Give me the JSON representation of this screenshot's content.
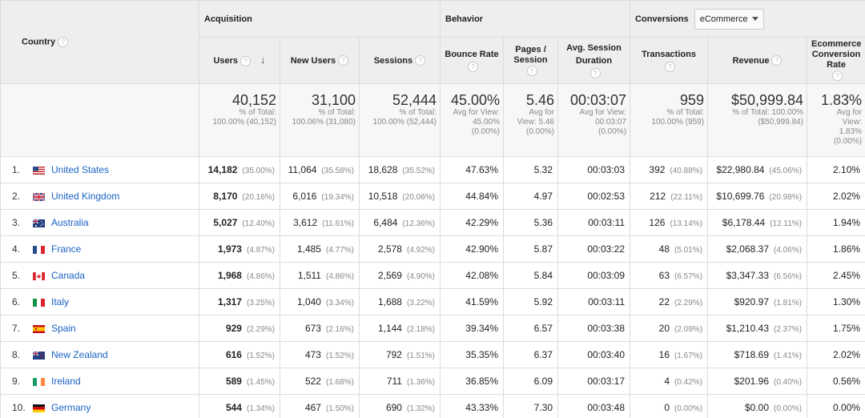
{
  "headers": {
    "country": "Country",
    "acquisition": "Acquisition",
    "behavior": "Behavior",
    "conversions": "Conversions",
    "conversions_dropdown": "eCommerce",
    "users": "Users",
    "new_users": "New Users",
    "sessions": "Sessions",
    "bounce_rate": "Bounce Rate",
    "pages_session": "Pages / Session",
    "avg_session_duration": "Avg. Session Duration",
    "transactions": "Transactions",
    "revenue": "Revenue",
    "ecommerce_conversion_rate": "Ecommerce Conversion Rate"
  },
  "totals": {
    "users": "40,152",
    "users_sub1": "% of Total:",
    "users_sub2": "100.00% (40,152)",
    "new_users": "31,100",
    "new_users_sub1": "% of Total:",
    "new_users_sub2": "100.06% (31,080)",
    "sessions": "52,444",
    "sessions_sub1": "% of Total:",
    "sessions_sub2": "100.00% (52,444)",
    "bounce_rate": "45.00%",
    "bounce_sub1": "Avg for View:",
    "bounce_sub2": "45.00%",
    "bounce_sub3": "(0.00%)",
    "pages_session": "5.46",
    "pages_sub1": "Avg for",
    "pages_sub2": "View: 5.46",
    "pages_sub3": "(0.00%)",
    "avg_duration": "00:03:07",
    "duration_sub1": "Avg for View:",
    "duration_sub2": "00:03:07",
    "duration_sub3": "(0.00%)",
    "transactions": "959",
    "transactions_sub1": "% of Total:",
    "transactions_sub2": "100.00% (959)",
    "revenue": "$50,999.84",
    "revenue_sub1": "% of Total: 100.00%",
    "revenue_sub2": "($50,999.84)",
    "conv_rate": "1.83%",
    "conv_sub1": "Avg for",
    "conv_sub2": "View:",
    "conv_sub3": "1.83%",
    "conv_sub4": "(0.00%)"
  },
  "rows": [
    {
      "idx": "1.",
      "flag": "us",
      "country": "United States",
      "users": "14,182",
      "users_pct": "(35.00%)",
      "new_users": "11,064",
      "new_users_pct": "(35.58%)",
      "sessions": "18,628",
      "sessions_pct": "(35.52%)",
      "bounce": "47.63%",
      "pages": "5.32",
      "duration": "00:03:03",
      "transactions": "392",
      "transactions_pct": "(40.88%)",
      "revenue": "$22,980.84",
      "revenue_pct": "(45.06%)",
      "conv": "2.10%"
    },
    {
      "idx": "2.",
      "flag": "gb",
      "country": "United Kingdom",
      "users": "8,170",
      "users_pct": "(20.16%)",
      "new_users": "6,016",
      "new_users_pct": "(19.34%)",
      "sessions": "10,518",
      "sessions_pct": "(20.06%)",
      "bounce": "44.84%",
      "pages": "4.97",
      "duration": "00:02:53",
      "transactions": "212",
      "transactions_pct": "(22.11%)",
      "revenue": "$10,699.76",
      "revenue_pct": "(20.98%)",
      "conv": "2.02%"
    },
    {
      "idx": "3.",
      "flag": "au",
      "country": "Australia",
      "users": "5,027",
      "users_pct": "(12.40%)",
      "new_users": "3,612",
      "new_users_pct": "(11.61%)",
      "sessions": "6,484",
      "sessions_pct": "(12.36%)",
      "bounce": "42.29%",
      "pages": "5.36",
      "duration": "00:03:11",
      "transactions": "126",
      "transactions_pct": "(13.14%)",
      "revenue": "$6,178.44",
      "revenue_pct": "(12.11%)",
      "conv": "1.94%"
    },
    {
      "idx": "4.",
      "flag": "fr",
      "country": "France",
      "users": "1,973",
      "users_pct": "(4.87%)",
      "new_users": "1,485",
      "new_users_pct": "(4.77%)",
      "sessions": "2,578",
      "sessions_pct": "(4.92%)",
      "bounce": "42.90%",
      "pages": "5.87",
      "duration": "00:03:22",
      "transactions": "48",
      "transactions_pct": "(5.01%)",
      "revenue": "$2,068.37",
      "revenue_pct": "(4.06%)",
      "conv": "1.86%"
    },
    {
      "idx": "5.",
      "flag": "ca",
      "country": "Canada",
      "users": "1,968",
      "users_pct": "(4.86%)",
      "new_users": "1,511",
      "new_users_pct": "(4.86%)",
      "sessions": "2,569",
      "sessions_pct": "(4.90%)",
      "bounce": "42.08%",
      "pages": "5.84",
      "duration": "00:03:09",
      "transactions": "63",
      "transactions_pct": "(6.57%)",
      "revenue": "$3,347.33",
      "revenue_pct": "(6.56%)",
      "conv": "2.45%"
    },
    {
      "idx": "6.",
      "flag": "it",
      "country": "Italy",
      "users": "1,317",
      "users_pct": "(3.25%)",
      "new_users": "1,040",
      "new_users_pct": "(3.34%)",
      "sessions": "1,688",
      "sessions_pct": "(3.22%)",
      "bounce": "41.59%",
      "pages": "5.92",
      "duration": "00:03:11",
      "transactions": "22",
      "transactions_pct": "(2.29%)",
      "revenue": "$920.97",
      "revenue_pct": "(1.81%)",
      "conv": "1.30%"
    },
    {
      "idx": "7.",
      "flag": "es",
      "country": "Spain",
      "users": "929",
      "users_pct": "(2.29%)",
      "new_users": "673",
      "new_users_pct": "(2.16%)",
      "sessions": "1,144",
      "sessions_pct": "(2.18%)",
      "bounce": "39.34%",
      "pages": "6.57",
      "duration": "00:03:38",
      "transactions": "20",
      "transactions_pct": "(2.09%)",
      "revenue": "$1,210.43",
      "revenue_pct": "(2.37%)",
      "conv": "1.75%"
    },
    {
      "idx": "8.",
      "flag": "nz",
      "country": "New Zealand",
      "users": "616",
      "users_pct": "(1.52%)",
      "new_users": "473",
      "new_users_pct": "(1.52%)",
      "sessions": "792",
      "sessions_pct": "(1.51%)",
      "bounce": "35.35%",
      "pages": "6.37",
      "duration": "00:03:40",
      "transactions": "16",
      "transactions_pct": "(1.67%)",
      "revenue": "$718.69",
      "revenue_pct": "(1.41%)",
      "conv": "2.02%"
    },
    {
      "idx": "9.",
      "flag": "ie",
      "country": "Ireland",
      "users": "589",
      "users_pct": "(1.45%)",
      "new_users": "522",
      "new_users_pct": "(1.68%)",
      "sessions": "711",
      "sessions_pct": "(1.36%)",
      "bounce": "36.85%",
      "pages": "6.09",
      "duration": "00:03:17",
      "transactions": "4",
      "transactions_pct": "(0.42%)",
      "revenue": "$201.96",
      "revenue_pct": "(0.40%)",
      "conv": "0.56%"
    },
    {
      "idx": "10.",
      "flag": "de",
      "country": "Germany",
      "users": "544",
      "users_pct": "(1.34%)",
      "new_users": "467",
      "new_users_pct": "(1.50%)",
      "sessions": "690",
      "sessions_pct": "(1.32%)",
      "bounce": "43.33%",
      "pages": "7.30",
      "duration": "00:03:48",
      "transactions": "0",
      "transactions_pct": "(0.00%)",
      "revenue": "$0.00",
      "revenue_pct": "(0.00%)",
      "conv": "0.00%"
    }
  ],
  "colors": {
    "link": "#1a63c6",
    "header_bg": "#eeeeee",
    "border": "#dcdcdc"
  }
}
